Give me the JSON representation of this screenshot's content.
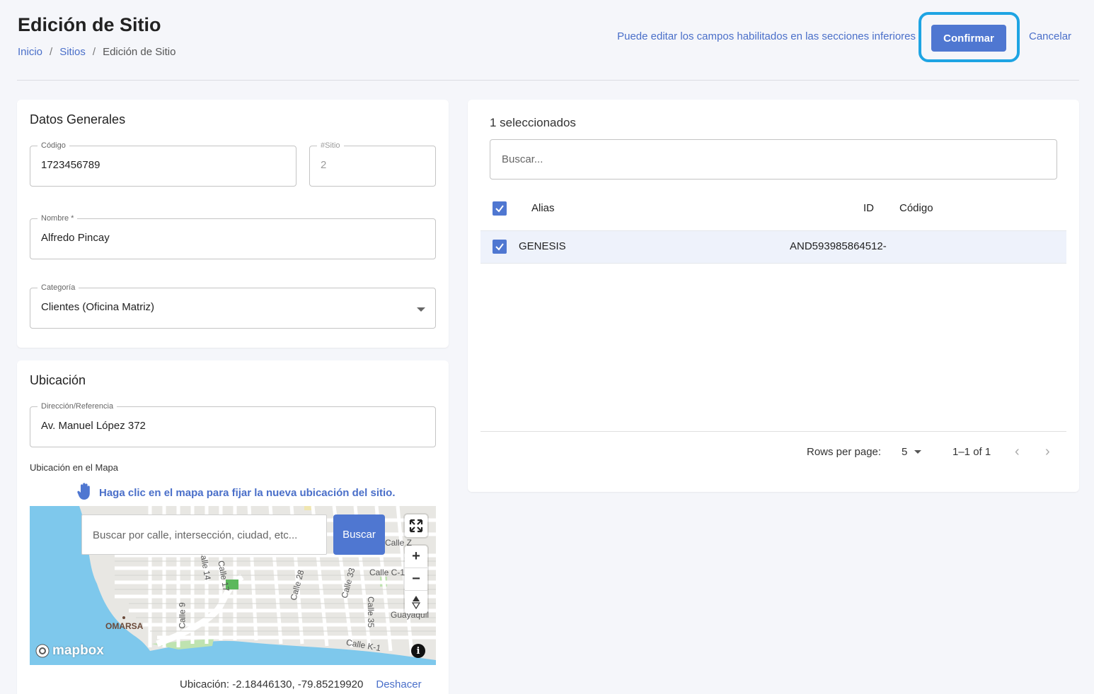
{
  "header": {
    "title": "Edición de Sitio",
    "breadcrumb": [
      {
        "label": "Inicio"
      },
      {
        "label": "Sitios"
      },
      {
        "label": "Edición de Sitio"
      }
    ],
    "breadcrumb_sep": "/",
    "hint": "Puede editar los campos habilitados en las secciones inferiores",
    "confirm_label": "Confirmar",
    "cancel_label": "Cancelar"
  },
  "general": {
    "title": "Datos Generales",
    "codigo": {
      "label": "Código",
      "value": "1723456789"
    },
    "sitio": {
      "label": "#Sitio",
      "value": "2"
    },
    "nombre": {
      "label": "Nombre *",
      "value": "Alfredo Pincay"
    },
    "categoria": {
      "label": "Categoría",
      "value": "Clientes (Oficina Matriz)"
    }
  },
  "ubicacion": {
    "title": "Ubicación",
    "direccion": {
      "label": "Dirección/Referencia",
      "value": "Av. Manuel López 372"
    },
    "map_label": "Ubicación en el Mapa",
    "map_hint": "Haga clic en el mapa para fijar la nueva ubicación del sitio.",
    "map_search_placeholder": "Buscar por calle, intersección, ciudad, etc...",
    "map_search_button": "Buscar",
    "map_brand": "mapbox",
    "map_labels": [
      "Calle Z",
      "Calle C-1",
      "Calle 28",
      "Calle 33",
      "Calle 35",
      "Calle 9",
      "Calle K-1",
      "Guayaquil",
      "OMARSA",
      "Calle 17",
      "Calle 14"
    ],
    "location_text": "Ubicación: -2.18446130, -79.85219920",
    "undo_label": "Deshacer"
  },
  "selection": {
    "count_text": "1 seleccionados",
    "search_placeholder": "Buscar...",
    "columns": [
      "Alias",
      "ID",
      "Código"
    ],
    "rows": [
      {
        "alias": "GENESIS",
        "id": "AND593985864512-",
        "codigo": ""
      }
    ],
    "pager": {
      "rows_label": "Rows per page:",
      "rows_value": "5",
      "range": "1–1 of 1"
    }
  },
  "colors": {
    "accent": "#4f77d1",
    "highlight": "#1ea4e3",
    "link": "#4a6fc9"
  }
}
